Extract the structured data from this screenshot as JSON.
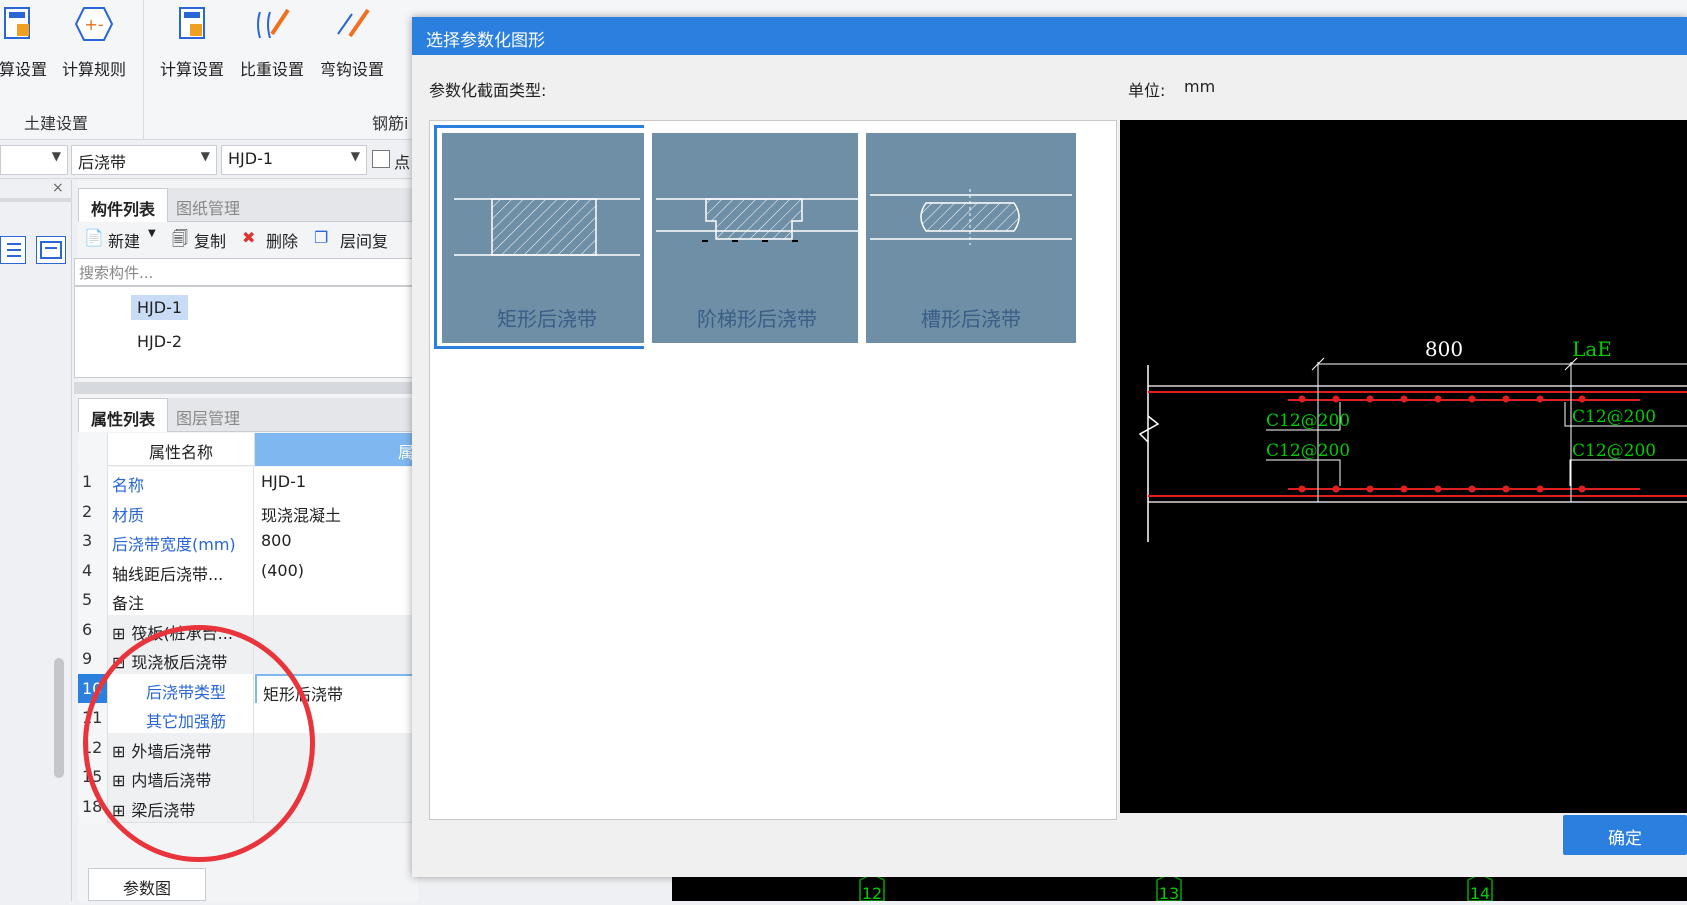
{
  "ribbon": {
    "btn_calc_settings_1": "算设置",
    "btn_calc_rules": "计算规则",
    "btn_calc_settings_2": "计算设置",
    "btn_weight_settings": "比重设置",
    "btn_hook_settings": "弯钩设置",
    "group_civil": "土建设置",
    "group_rebar": "钢筋i"
  },
  "toolbar2": {
    "combo_type": "后浇带",
    "combo_item": "HJD-1",
    "checkbox_label": "点"
  },
  "component_list": {
    "tab_active": "构件列表",
    "tab_inactive": "图纸管理",
    "btn_new": "新建",
    "btn_copy": "复制",
    "btn_delete": "删除",
    "btn_floor_copy": "层间复",
    "search_placeholder": "搜索构件...",
    "items": [
      "HJD-1",
      "HJD-2"
    ]
  },
  "property_list": {
    "tab_active": "属性列表",
    "tab_inactive": "图层管理",
    "header_name": "属性名称",
    "header_value": "属",
    "rows": [
      {
        "num": "1",
        "name": "名称",
        "value": "HJD-1"
      },
      {
        "num": "2",
        "name": "材质",
        "value": "现浇混凝土"
      },
      {
        "num": "3",
        "name": "后浇带宽度(mm)",
        "value": "800"
      },
      {
        "num": "4",
        "name": "轴线距后浇带...",
        "value": "(400)"
      },
      {
        "num": "5",
        "name": "备注",
        "value": ""
      },
      {
        "num": "6",
        "name": "筏板(桩承台...",
        "value": ""
      },
      {
        "num": "9",
        "name": "现浇板后浇带",
        "value": ""
      },
      {
        "num": "10",
        "name": "后浇带类型",
        "value": "矩形后浇带"
      },
      {
        "num": "11",
        "name": "其它加强筋",
        "value": ""
      },
      {
        "num": "12",
        "name": "外墙后浇带",
        "value": ""
      },
      {
        "num": "15",
        "name": "内墙后浇带",
        "value": ""
      },
      {
        "num": "18",
        "name": "梁后浇带",
        "value": ""
      }
    ]
  },
  "bottom_tab": "参数图",
  "dialog": {
    "title": "选择参数化图形",
    "section_label": "参数化截面类型:",
    "unit_label": "单位:",
    "unit_value": "mm",
    "shapes": [
      "矩形后浇带",
      "阶梯形后浇带",
      "槽形后浇带"
    ],
    "preview": {
      "dim_width": "800",
      "dim_lae": "LaE",
      "rebar_labels": [
        "C12@200",
        "C12@200",
        "C12@200",
        "C12@200"
      ]
    },
    "ok_label": "确定"
  },
  "bottom_axis": [
    "12",
    "13",
    "14"
  ]
}
